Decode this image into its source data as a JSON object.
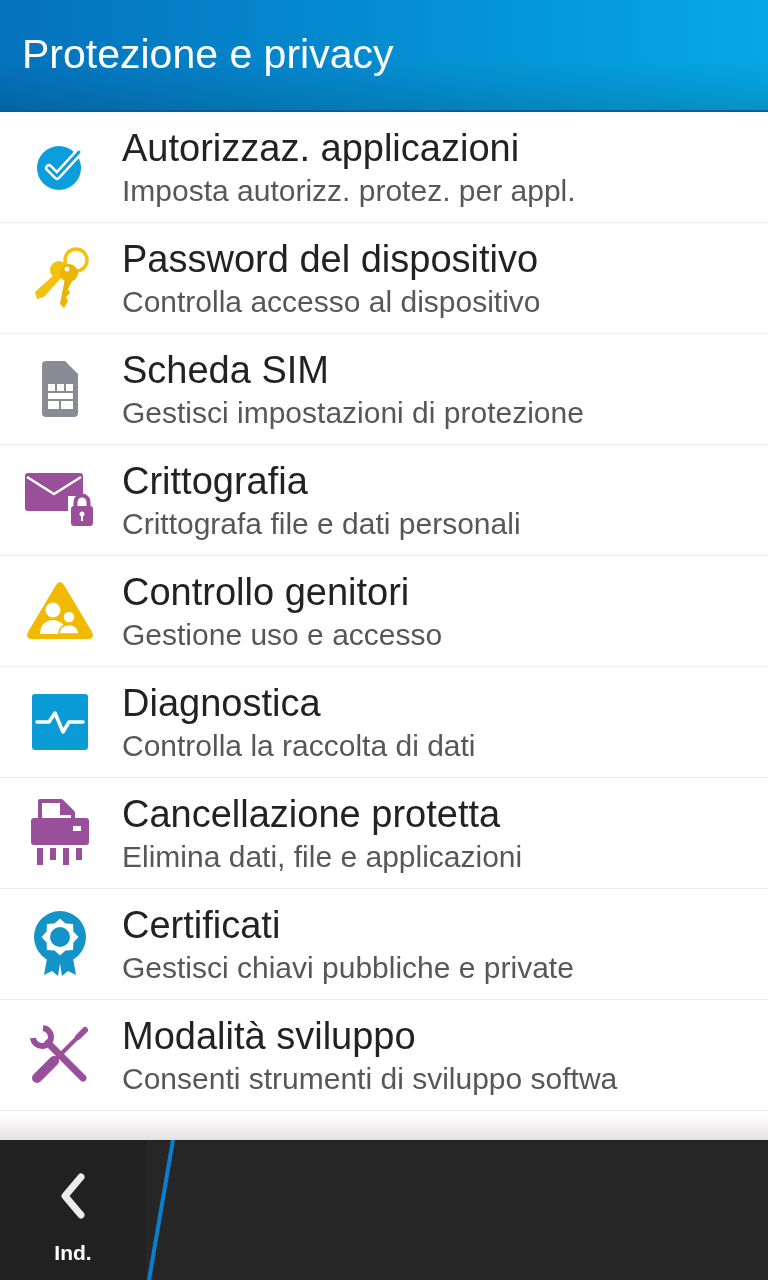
{
  "header": {
    "title": "Protezione e privacy"
  },
  "items": [
    {
      "title": "Autorizzaz. applicazioni",
      "subtitle": "Imposta autorizz. protez. per appl."
    },
    {
      "title": "Password del dispositivo",
      "subtitle": "Controlla accesso al dispositivo"
    },
    {
      "title": "Scheda SIM",
      "subtitle": "Gestisci impostazioni di protezione"
    },
    {
      "title": "Crittografia",
      "subtitle": "Crittografa file e dati personali"
    },
    {
      "title": "Controllo genitori",
      "subtitle": "Gestione uso e accesso"
    },
    {
      "title": "Diagnostica",
      "subtitle": "Controlla la raccolta di dati"
    },
    {
      "title": "Cancellazione protetta",
      "subtitle": "Elimina dati, file e applicazioni"
    },
    {
      "title": "Certificati",
      "subtitle": "Gestisci chiavi pubbliche e private"
    },
    {
      "title": "Modalità sviluppo",
      "subtitle": "Consenti strumenti di sviluppo softwa"
    }
  ],
  "action_bar": {
    "back_label": "Ind."
  }
}
